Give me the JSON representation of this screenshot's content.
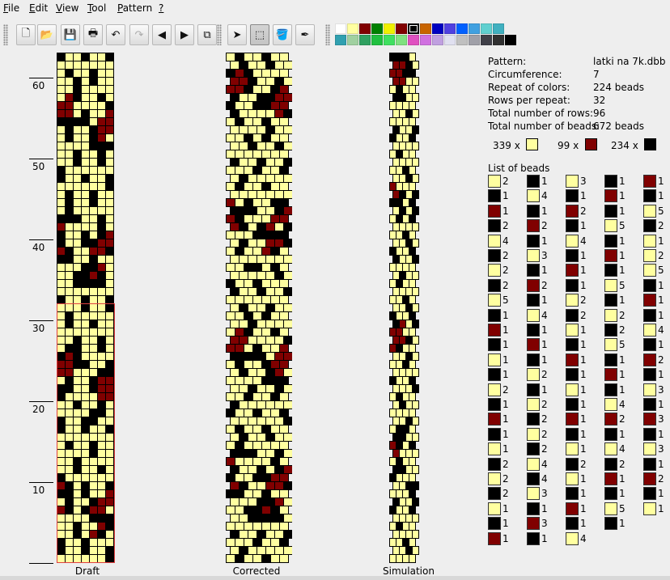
{
  "menu": [
    {
      "key": "file",
      "label": "File"
    },
    {
      "key": "edit",
      "label": "Edit"
    },
    {
      "key": "view",
      "label": "View"
    },
    {
      "key": "tool",
      "label": "Tool"
    },
    {
      "key": "pattern",
      "label": "Pattern"
    },
    {
      "key": "help",
      "label": "?"
    }
  ],
  "toolbar": {
    "buttons": [
      {
        "name": "new-button",
        "icon": "new-document-icon",
        "glyph": "🗋"
      },
      {
        "name": "open-button",
        "icon": "open-folder-icon",
        "glyph": "📂"
      },
      {
        "name": "save-button",
        "icon": "floppy-disk-icon",
        "glyph": "💾"
      },
      {
        "name": "print-button",
        "icon": "printer-icon",
        "glyph": "🖶"
      },
      {
        "name": "undo-button",
        "icon": "undo-arrow-icon",
        "glyph": "↶"
      },
      {
        "name": "redo-button",
        "icon": "redo-arrow-icon",
        "glyph": "↷",
        "disabled": true
      },
      {
        "name": "previous-button",
        "icon": "triangle-left-icon",
        "glyph": "◀"
      },
      {
        "name": "next-button",
        "icon": "triangle-right-icon",
        "glyph": "▶"
      },
      {
        "name": "copy-button",
        "icon": "copy-pages-icon",
        "glyph": "⧉"
      },
      {
        "name": "pointer-tool-button",
        "icon": "pointer-arrow-icon",
        "glyph": "➤"
      },
      {
        "name": "select-tool-button",
        "icon": "dashed-rectangle-icon",
        "glyph": "⬚",
        "selected": true
      },
      {
        "name": "fill-tool-button",
        "icon": "paint-bucket-icon",
        "glyph": "🪣"
      },
      {
        "name": "pipette-tool-button",
        "icon": "eyedropper-icon",
        "glyph": "✒"
      }
    ]
  },
  "palette": {
    "selected_index": 6,
    "colors": [
      "#ffffff",
      "#ffffa0",
      "#800000",
      "#008000",
      "#f0f000",
      "#800000",
      "#000000",
      "#c86400",
      "#0000c0",
      "#5040e0",
      "#0060ff",
      "#40a0e0",
      "#60d0d0",
      "#40b0c0",
      "#30a0b0",
      "#a0d0a0",
      "#30a060",
      "#20c040",
      "#40e060",
      "#80e080",
      "#e050c0",
      "#d070e0",
      "#c0a0e0",
      "#e0e0f0",
      "#c0c0c0",
      "#a0a0a8",
      "#404048",
      "#303030",
      "#000000"
    ]
  },
  "colors": {
    "light": "#ffffa0",
    "dark": "#000000",
    "red": "#800000",
    "window_bg": "#eeeeee"
  },
  "ruler": [
    {
      "label": "60",
      "row": 60
    },
    {
      "label": "50",
      "row": 50
    },
    {
      "label": "40",
      "row": 40
    },
    {
      "label": "30",
      "row": 30
    },
    {
      "label": "20",
      "row": 20
    },
    {
      "label": "10",
      "row": 10
    }
  ],
  "panels": {
    "draft_label": "Draft",
    "corrected_label": "Corrected",
    "simulation_label": "Simulation"
  },
  "info": {
    "rows": [
      {
        "key": "Pattern:",
        "value": "latki na 7k.dbb"
      },
      {
        "key": "Circumference:",
        "value": "7"
      },
      {
        "key": "Repeat of colors:",
        "value": "224 beads"
      },
      {
        "key": "Rows per repeat:",
        "value": "32"
      },
      {
        "key": "Total number of rows:",
        "value": "96"
      },
      {
        "key": "Total number of beads:",
        "value": "672 beads"
      }
    ],
    "counts": [
      {
        "count": "339 x",
        "color": "light"
      },
      {
        "count": "99 x",
        "color": "red"
      },
      {
        "count": "234 x",
        "color": "dark"
      }
    ]
  },
  "bead_list": {
    "title": "List of beads",
    "columns": [
      [
        [
          "L",
          "2"
        ],
        [
          "D",
          "1"
        ],
        [
          "R",
          "1"
        ],
        [
          "D",
          "2"
        ],
        [
          "L",
          "4"
        ],
        [
          "D",
          "2"
        ],
        [
          "L",
          "2"
        ],
        [
          "D",
          "2"
        ],
        [
          "L",
          "5"
        ],
        [
          "D",
          "1"
        ],
        [
          "R",
          "1"
        ],
        [
          "D",
          "1"
        ],
        [
          "L",
          "1"
        ],
        [
          "D",
          "1"
        ],
        [
          "L",
          "2"
        ],
        [
          "D",
          "1"
        ],
        [
          "R",
          "1"
        ],
        [
          "D",
          "1"
        ],
        [
          "L",
          "1"
        ],
        [
          "D",
          "2"
        ],
        [
          "L",
          "2"
        ],
        [
          "D",
          "2"
        ],
        [
          "L",
          "1"
        ],
        [
          "D",
          "1"
        ],
        [
          "R",
          "1"
        ]
      ],
      [
        [
          "D",
          "1"
        ],
        [
          "L",
          "4"
        ],
        [
          "D",
          "1"
        ],
        [
          "R",
          "2"
        ],
        [
          "D",
          "1"
        ],
        [
          "L",
          "3"
        ],
        [
          "D",
          "1"
        ],
        [
          "R",
          "2"
        ],
        [
          "D",
          "1"
        ],
        [
          "L",
          "4"
        ],
        [
          "D",
          "1"
        ],
        [
          "R",
          "1"
        ],
        [
          "D",
          "1"
        ],
        [
          "L",
          "2"
        ],
        [
          "D",
          "1"
        ],
        [
          "L",
          "2"
        ],
        [
          "D",
          "2"
        ],
        [
          "L",
          "2"
        ],
        [
          "D",
          "2"
        ],
        [
          "L",
          "4"
        ],
        [
          "D",
          "4"
        ],
        [
          "L",
          "3"
        ],
        [
          "D",
          "1"
        ],
        [
          "R",
          "3"
        ],
        [
          "D",
          "1"
        ]
      ],
      [
        [
          "L",
          "3"
        ],
        [
          "D",
          "1"
        ],
        [
          "R",
          "2"
        ],
        [
          "D",
          "1"
        ],
        [
          "L",
          "4"
        ],
        [
          "D",
          "1"
        ],
        [
          "R",
          "1"
        ],
        [
          "D",
          "1"
        ],
        [
          "L",
          "2"
        ],
        [
          "D",
          "2"
        ],
        [
          "L",
          "1"
        ],
        [
          "D",
          "1"
        ],
        [
          "R",
          "1"
        ],
        [
          "D",
          "1"
        ],
        [
          "L",
          "1"
        ],
        [
          "D",
          "1"
        ],
        [
          "R",
          "1"
        ],
        [
          "D",
          "1"
        ],
        [
          "L",
          "1"
        ],
        [
          "D",
          "2"
        ],
        [
          "L",
          "1"
        ],
        [
          "D",
          "1"
        ],
        [
          "R",
          "1"
        ],
        [
          "D",
          "1"
        ],
        [
          "L",
          "4"
        ]
      ],
      [
        [
          "D",
          "1"
        ],
        [
          "R",
          "1"
        ],
        [
          "D",
          "1"
        ],
        [
          "L",
          "5"
        ],
        [
          "D",
          "1"
        ],
        [
          "R",
          "1"
        ],
        [
          "D",
          "1"
        ],
        [
          "L",
          "5"
        ],
        [
          "D",
          "1"
        ],
        [
          "L",
          "2"
        ],
        [
          "D",
          "2"
        ],
        [
          "L",
          "5"
        ],
        [
          "D",
          "1"
        ],
        [
          "R",
          "1"
        ],
        [
          "D",
          "1"
        ],
        [
          "L",
          "4"
        ],
        [
          "R",
          "2"
        ],
        [
          "D",
          "1"
        ],
        [
          "L",
          "4"
        ],
        [
          "D",
          "2"
        ],
        [
          "R",
          "1"
        ],
        [
          "D",
          "1"
        ],
        [
          "L",
          "5"
        ],
        [
          "D",
          "1"
        ]
      ],
      [
        [
          "R",
          "1"
        ],
        [
          "D",
          "1"
        ],
        [
          "L",
          "5"
        ],
        [
          "D",
          "2"
        ],
        [
          "L",
          "1"
        ],
        [
          "L",
          "2"
        ],
        [
          "L",
          "5"
        ],
        [
          "D",
          "1"
        ],
        [
          "R",
          "1"
        ],
        [
          "D",
          "1"
        ],
        [
          "L",
          "4"
        ],
        [
          "D",
          "1"
        ],
        [
          "R",
          "2"
        ],
        [
          "D",
          "1"
        ],
        [
          "L",
          "3"
        ],
        [
          "D",
          "1"
        ],
        [
          "R",
          "3"
        ],
        [
          "D",
          "1"
        ],
        [
          "L",
          "3"
        ],
        [
          "D",
          "1"
        ],
        [
          "R",
          "2"
        ],
        [
          "D",
          "1"
        ],
        [
          "L",
          "1"
        ]
      ]
    ]
  }
}
